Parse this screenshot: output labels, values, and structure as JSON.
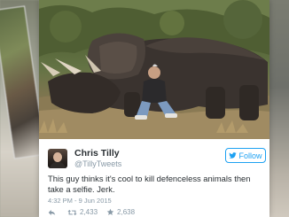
{
  "tweet": {
    "author_name": "Chris Tilly",
    "author_handle": "@TillyTweets",
    "follow_label": "Follow",
    "text": "This guy thinks it's cool to kill defenceless animals then take a selfie. Jerk.",
    "timestamp": "4:32 PM - 9 Jun 2015",
    "retweets": "2,433",
    "likes": "2,638"
  },
  "icons": {
    "reply": "reply-icon",
    "retweet": "retweet-icon",
    "like": "star-icon",
    "follow": "twitter-bird-icon"
  },
  "colors": {
    "twitter_blue": "#1da1f2",
    "meta_gray": "#8899a6",
    "text_dark": "#292f33"
  }
}
